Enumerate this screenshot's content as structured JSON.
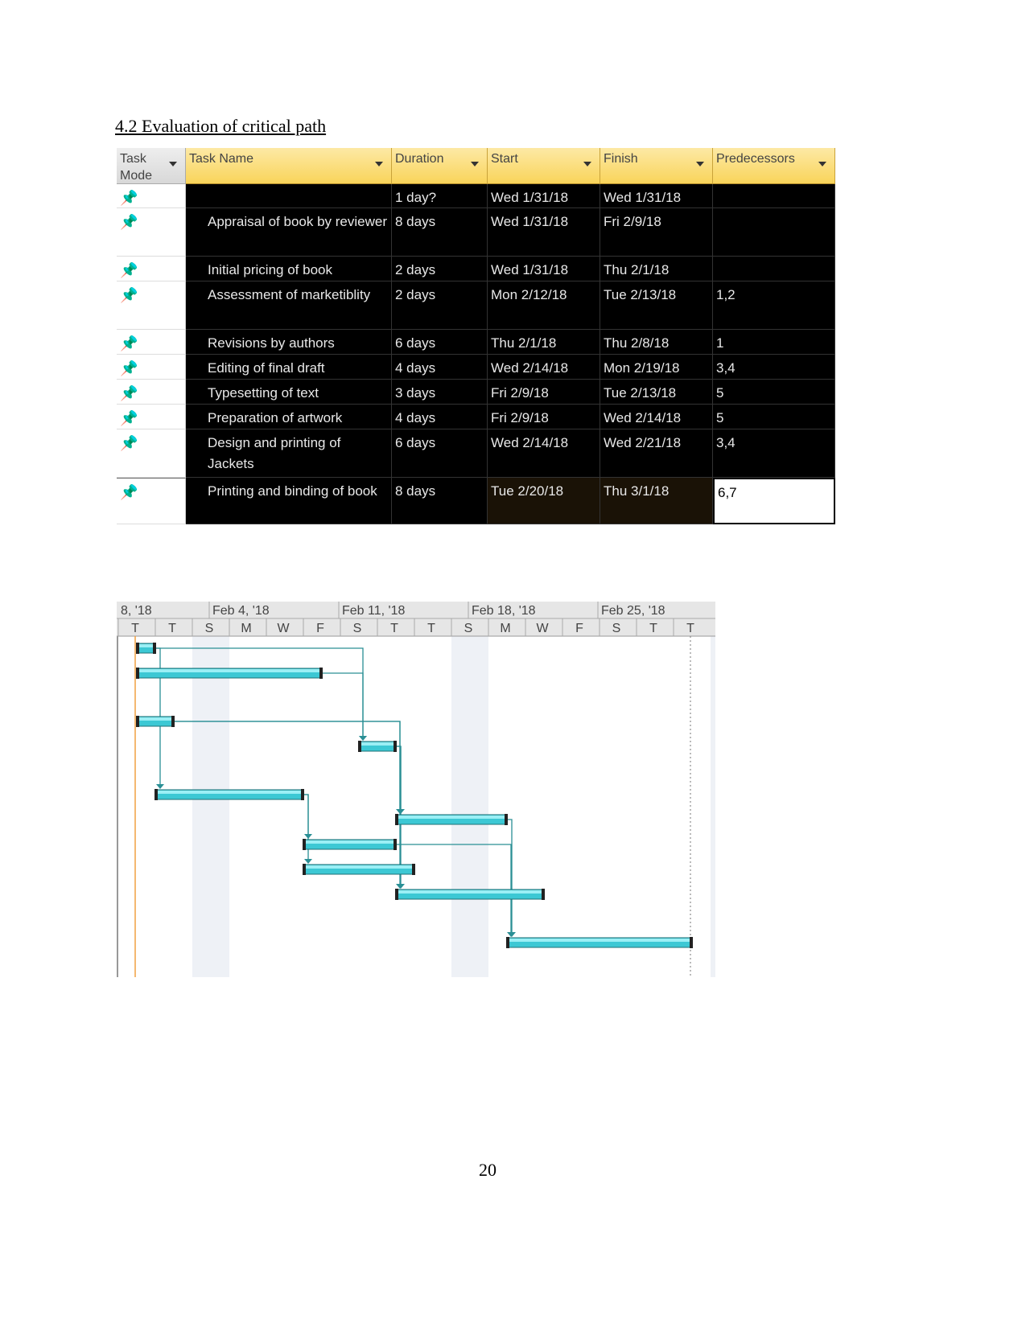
{
  "title": "4.2 Evaluation of critical path",
  "page_number": "20",
  "table": {
    "columns": [
      "Task Mode",
      "Task Name",
      "Duration",
      "Start",
      "Finish",
      "Predecessors"
    ],
    "rows": [
      {
        "id": 1,
        "name": "",
        "duration": "1 day?",
        "start": "Wed 1/31/18",
        "finish": "Wed 1/31/18",
        "predecessors": ""
      },
      {
        "id": 2,
        "name": "Appraisal of book by reviewer",
        "duration": "8 days",
        "start": "Wed 1/31/18",
        "finish": "Fri 2/9/18",
        "predecessors": ""
      },
      {
        "id": 3,
        "name": "Initial pricing of book",
        "duration": "2 days",
        "start": "Wed 1/31/18",
        "finish": "Thu 2/1/18",
        "predecessors": ""
      },
      {
        "id": 4,
        "name": "Assessment of marketiblity",
        "duration": "2 days",
        "start": "Mon 2/12/18",
        "finish": "Tue 2/13/18",
        "predecessors": "1,2"
      },
      {
        "id": 5,
        "name": "Revisions by authors",
        "duration": "6 days",
        "start": "Thu 2/1/18",
        "finish": "Thu 2/8/18",
        "predecessors": "1"
      },
      {
        "id": 6,
        "name": "Editing of final draft",
        "duration": "4 days",
        "start": "Wed 2/14/18",
        "finish": "Mon 2/19/18",
        "predecessors": "3,4"
      },
      {
        "id": 7,
        "name": "Typesetting of text",
        "duration": "3 days",
        "start": "Fri 2/9/18",
        "finish": "Tue 2/13/18",
        "predecessors": "5"
      },
      {
        "id": 8,
        "name": "Preparation of artwork",
        "duration": "4 days",
        "start": "Fri 2/9/18",
        "finish": "Wed 2/14/18",
        "predecessors": "5"
      },
      {
        "id": 9,
        "name": "Design and printing of Jackets",
        "duration": "6 days",
        "start": "Wed 2/14/18",
        "finish": "Wed 2/21/18",
        "predecessors": "3,4"
      },
      {
        "id": 10,
        "name": "Printing and binding of book",
        "duration": "8 days",
        "start": "Tue 2/20/18",
        "finish": "Thu 3/1/18",
        "predecessors": "6,7"
      }
    ]
  },
  "gantt": {
    "weeks": [
      "8, '18",
      "Feb 4, '18",
      "Feb 11, '18",
      "Feb 18, '18",
      "Feb 25, '18"
    ],
    "days": [
      "T",
      "T",
      "S",
      "M",
      "W",
      "F",
      "S",
      "T",
      "T",
      "S",
      "M",
      "W",
      "F",
      "S",
      "T",
      "T"
    ],
    "bars": [
      [
        0,
        1
      ],
      [
        0,
        10
      ],
      [
        0,
        2
      ],
      [
        12,
        14
      ],
      [
        1,
        9
      ],
      [
        14,
        20
      ],
      [
        9,
        14
      ],
      [
        9,
        15
      ],
      [
        14,
        22
      ],
      [
        20,
        30
      ]
    ],
    "bar_color": "#3cc8d4",
    "link_color": "#2a8f95",
    "today_line_color": "#f0a040"
  },
  "icons": {
    "task_mode": "pushpin-icon",
    "dropdown": "chevron-down-icon"
  }
}
